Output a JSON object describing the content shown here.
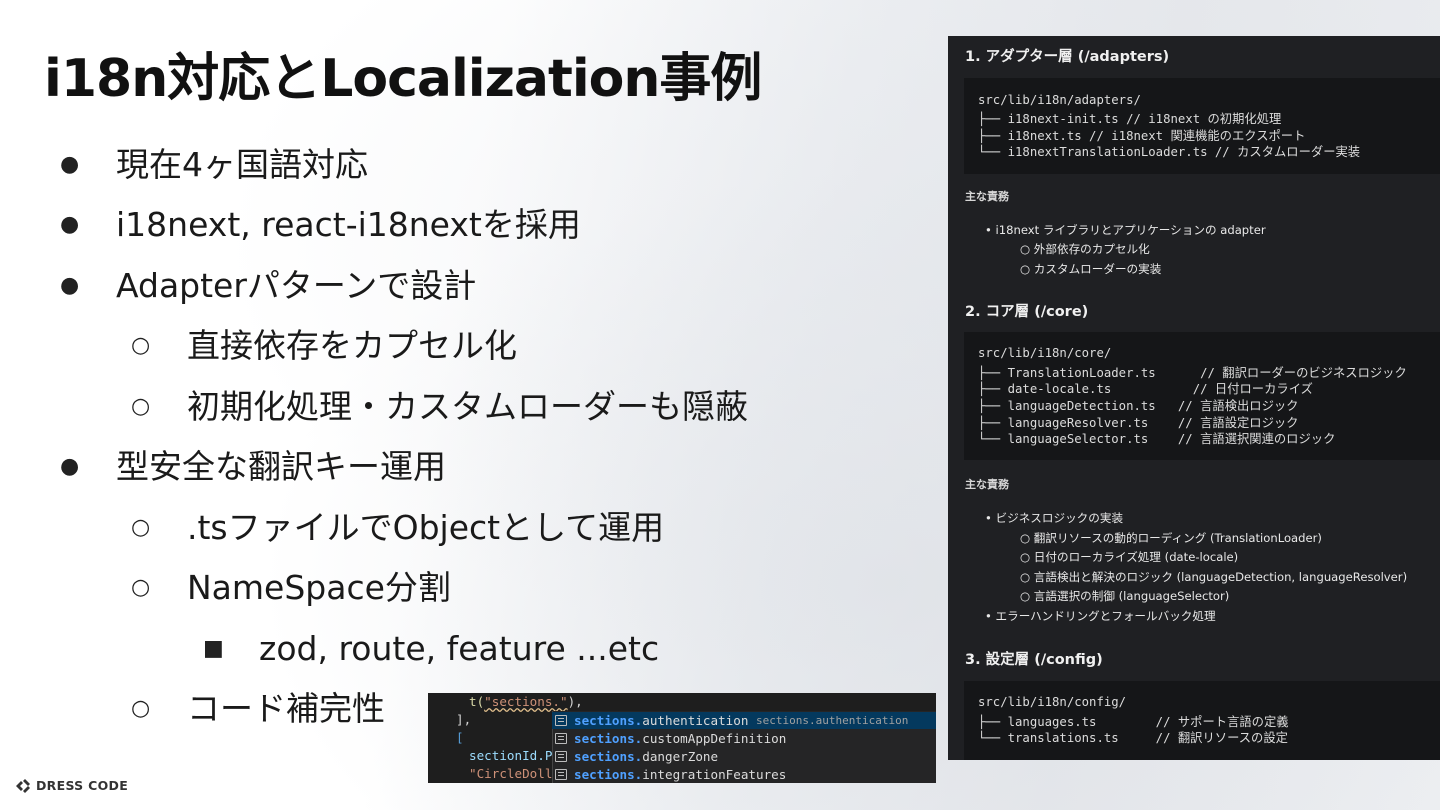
{
  "slide": {
    "title": "i18n対応とLocalization事例",
    "bullets": [
      {
        "marker": "●",
        "text": "現在4ヶ国語対応"
      },
      {
        "marker": "●",
        "text": "i18next, react-i18nextを採用"
      },
      {
        "marker": "●",
        "text": "Adapterパターンで設計"
      },
      {
        "marker": "○",
        "text": "直接依存をカプセル化"
      },
      {
        "marker": "○",
        "text": "初期化処理・カスタムローダーも隠蔽"
      },
      {
        "marker": "●",
        "text": "型安全な翻訳キー運用"
      },
      {
        "marker": "○",
        "text": ".tsファイルでObjectとして運用"
      },
      {
        "marker": "○",
        "text": "NameSpace分割"
      },
      {
        "marker": "■",
        "text": "zod, route, feature ...etc"
      },
      {
        "marker": "○",
        "text": "コード補完性"
      }
    ]
  },
  "panel": {
    "h1": "1. アダプター層 (/adapters)",
    "code1": [
      "src/lib/i18n/adapters/",
      "├── i18next-init.ts // i18next の初期化処理",
      "├── i18next.ts // i18next 関連機能のエクスポート",
      "└── i18nextTranslationLoader.ts // カスタムローダー実装"
    ],
    "resp1_heading": "主な責務",
    "resp1": [
      "• i18next ライブラリとアプリケーションの adapter",
      "○ 外部依存のカプセル化",
      "○ カスタムローダーの実装"
    ],
    "h2": "2. コア層 (/core)",
    "code2": [
      "src/lib/i18n/core/",
      "├── TranslationLoader.ts      // 翻訳ローダーのビジネスロジック",
      "├── date-locale.ts           // 日付ローカライズ",
      "├── languageDetection.ts   // 言語検出ロジック",
      "├── languageResolver.ts    // 言語設定ロジック",
      "└── languageSelector.ts    // 言語選択関連のロジック"
    ],
    "resp2_heading": "主な責務",
    "resp2": [
      "• ビジネスロジックの実装",
      "○ 翻訳リソースの動的ローディング (TranslationLoader)",
      "○ 日付のローカライズ処理 (date-locale)",
      "○ 言語検出と解決のロジック (languageDetection, languageResolver)",
      "○ 言語選択の制御 (languageSelector)",
      "• エラーハンドリングとフォールバック処理"
    ],
    "h3": "3. 設定層 (/config)",
    "code3": [
      "src/lib/i18n/config/",
      "├── languages.ts        // サポート言語の定義",
      "└── translations.ts     // 翻訳リソースの設定"
    ]
  },
  "autocomplete": {
    "line1_prefix": "t(",
    "line1_string": "\"sections.\"",
    "line1_suffix": "),",
    "line2": "],",
    "line3": "[",
    "line4": "sectionId.PR",
    "line5": "\"CircleDolla",
    "items": [
      {
        "prefix": "sections.",
        "rest": "authentication"
      },
      {
        "prefix": "sections.",
        "rest": "customAppDefinition"
      },
      {
        "prefix": "sections.",
        "rest": "dangerZone"
      },
      {
        "prefix": "sections.",
        "rest": "integrationFeatures"
      }
    ],
    "detail": "sections.authentication",
    "colors": {
      "bg": "#1e1e1e",
      "highlight": "#4fa0ff",
      "selected": "#04395e"
    }
  },
  "footer": {
    "logo_text": "DRESS CODE"
  }
}
